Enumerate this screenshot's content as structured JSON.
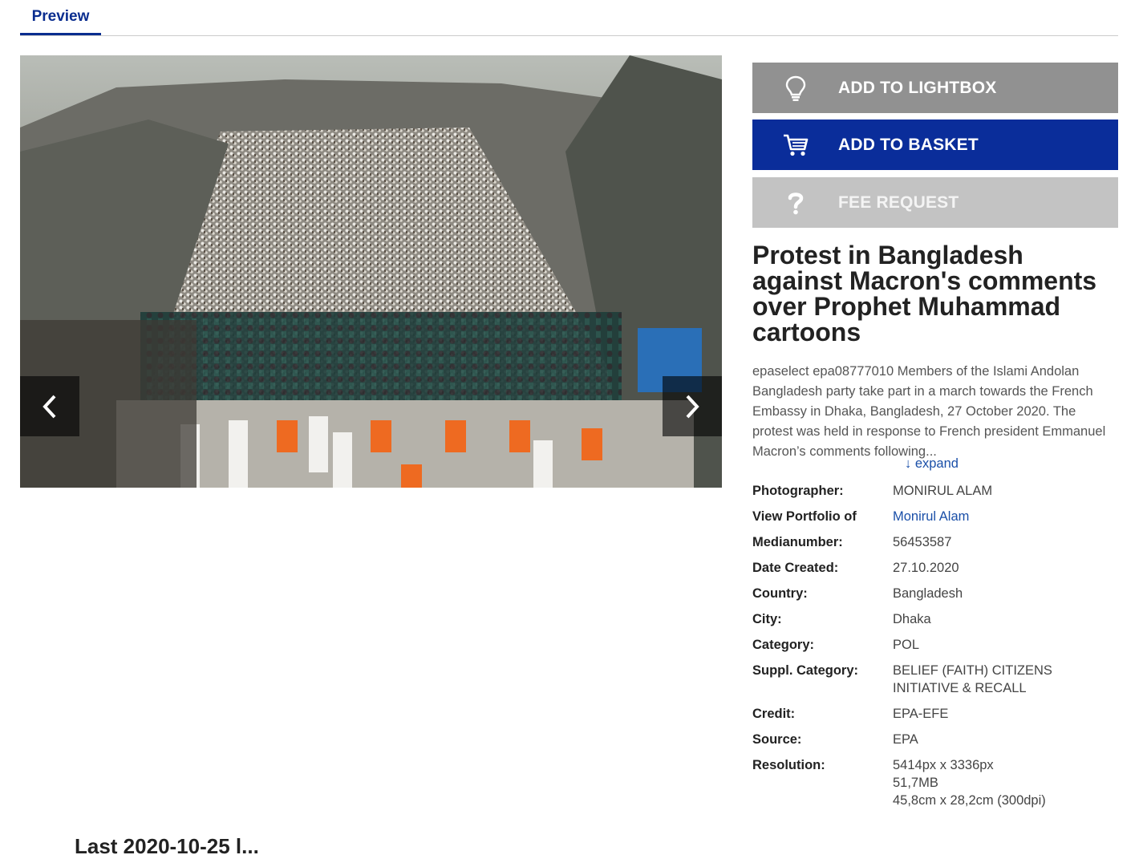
{
  "tabs": [
    {
      "label": "Preview",
      "active": true
    }
  ],
  "colors": {
    "accent": "#0a2d9a",
    "lightbox_button": "#919191",
    "fee_button": "#c3c3c3",
    "link": "#1a4fa8"
  },
  "preview": {
    "image_semantic": "crowd-protest-photo",
    "prev_icon": "chevron-left-icon",
    "next_icon": "chevron-right-icon"
  },
  "actions": {
    "lightbox": {
      "label": "ADD TO LIGHTBOX",
      "icon": "lightbulb-icon"
    },
    "basket": {
      "label": "ADD TO BASKET",
      "icon": "cart-icon"
    },
    "fee": {
      "label": "FEE REQUEST",
      "icon": "question-icon"
    }
  },
  "media": {
    "title": "Protest in Bangladesh against Macron's comments over Prophet Muhammad cartoons",
    "caption": "epaselect epa08777010 Members of the Islami Andolan Bangladesh party take part in a march towards the French Embassy in Dhaka, Bangladesh, 27 October 2020. The protest was held in response to French president Emmanuel Macron’s comments following...",
    "expand_label": "↓ expand"
  },
  "metadata": [
    {
      "label": "Photographer:",
      "value": "MONIRUL ALAM"
    },
    {
      "label": "View Portfolio of",
      "value": "Monirul Alam",
      "link": true
    },
    {
      "label": "Medianumber:",
      "value": "56453587"
    },
    {
      "label": "Date Created:",
      "value": "27.10.2020"
    },
    {
      "label": "Country:",
      "value": "Bangladesh"
    },
    {
      "label": "City:",
      "value": "Dhaka"
    },
    {
      "label": "Category:",
      "value": "POL"
    },
    {
      "label": "Suppl. Category:",
      "value": "BELIEF (FAITH) CITIZENS INITIATIVE & RECALL"
    },
    {
      "label": "Credit:",
      "value": "EPA-EFE"
    },
    {
      "label": "Source:",
      "value": "EPA"
    },
    {
      "label": "Resolution:",
      "value": "5414px x 3336px\n51,7MB\n45,8cm x 28,2cm (300dpi)"
    }
  ],
  "footer_fragment": "Last 2020-10-25 l..."
}
